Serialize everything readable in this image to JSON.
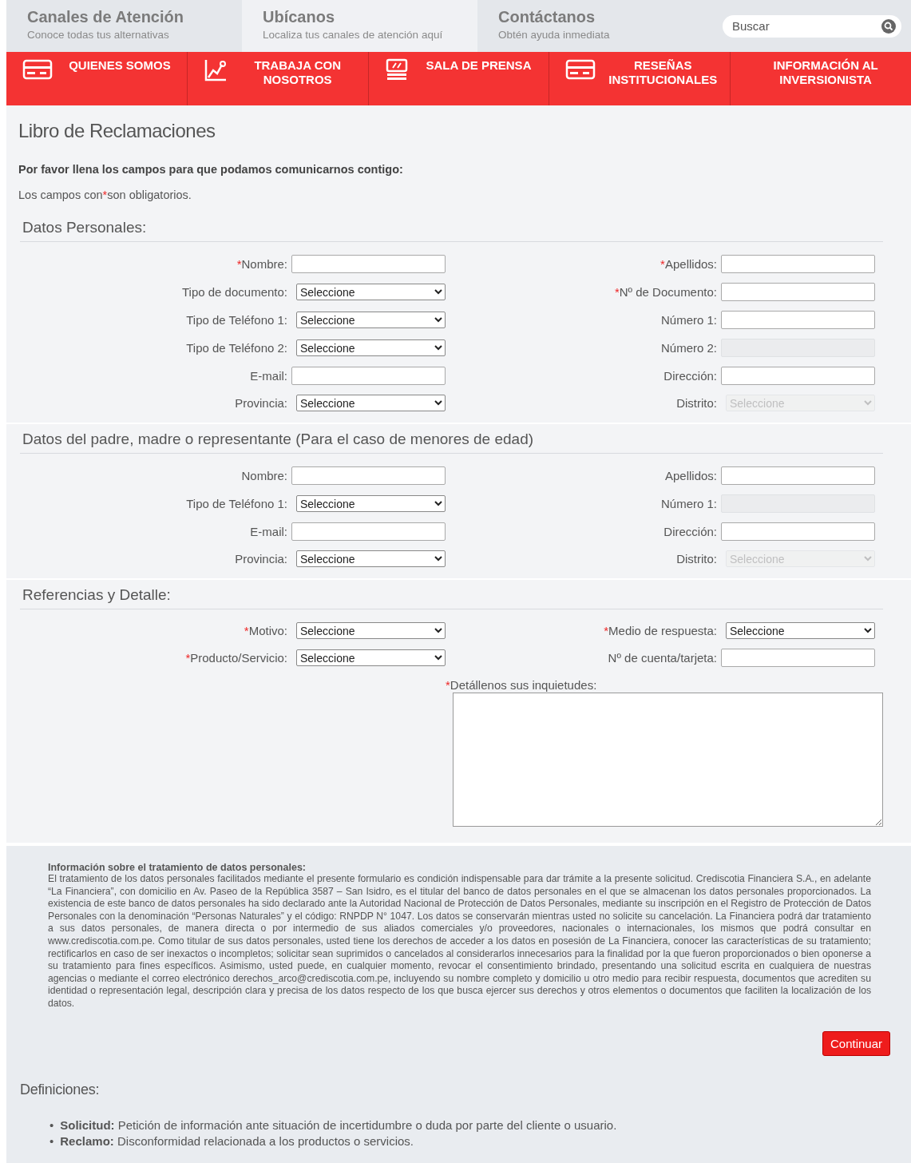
{
  "header": {
    "tabs": [
      {
        "title": "Canales de Atención",
        "subtitle": "Conoce todas tus alternativas",
        "selected": false
      },
      {
        "title": "Ubícanos",
        "subtitle": "Localiza tus canales de atención aquí",
        "selected": true
      },
      {
        "title": "Contáctanos",
        "subtitle": "Obtén ayuda inmediata",
        "selected": false
      }
    ],
    "search": {
      "placeholder": "Buscar"
    }
  },
  "nav": [
    {
      "label": "QUIENES SOMOS"
    },
    {
      "label": "TRABAJA CON NOSOTROS"
    },
    {
      "label": "SALA DE PRENSA"
    },
    {
      "label": "RESEÑAS INSTITUCIONALES"
    },
    {
      "label": "INFORMACIÓN AL INVERSIONISTA"
    }
  ],
  "page_title": "Libro de Reclamaciones",
  "intro": "Por favor llena los campos para que podamos comunicarnos contigo:",
  "required_mark": "*",
  "required_note": {
    "before": "Los campos con",
    "after": "son obligatorios."
  },
  "sections": [
    {
      "title": "Datos Personales:",
      "rows": [
        [
          {
            "label": "Nombre:",
            "required": true,
            "kind": "text",
            "disabled": false
          },
          {
            "label": "Apellidos:",
            "required": true,
            "kind": "text",
            "disabled": false
          }
        ],
        [
          {
            "label": "Tipo de documento:",
            "required": false,
            "kind": "select",
            "value": "Seleccione",
            "disabled": false
          },
          {
            "label": "Nº de Documento:",
            "required": true,
            "kind": "text",
            "disabled": false
          }
        ],
        [
          {
            "label": "Tipo de Teléfono 1:",
            "required": false,
            "kind": "select",
            "value": "Seleccione",
            "disabled": false
          },
          {
            "label": "Número 1:",
            "required": false,
            "kind": "text",
            "disabled": false
          }
        ],
        [
          {
            "label": "Tipo de Teléfono 2:",
            "required": false,
            "kind": "select",
            "value": "Seleccione",
            "disabled": false
          },
          {
            "label": "Número 2:",
            "required": false,
            "kind": "text",
            "disabled": true
          }
        ],
        [
          {
            "label": "E-mail:",
            "required": false,
            "kind": "text",
            "disabled": false
          },
          {
            "label": "Dirección:",
            "required": false,
            "kind": "text",
            "disabled": false
          }
        ],
        [
          {
            "label": "Provincia:",
            "required": false,
            "kind": "select",
            "value": "Seleccione",
            "disabled": false
          },
          {
            "label": "Distrito:",
            "required": false,
            "kind": "select",
            "value": "Seleccione",
            "disabled": true
          }
        ]
      ]
    },
    {
      "title": "Datos del padre, madre o representante (Para el caso de menores de edad)",
      "rows": [
        [
          {
            "label": "Nombre:",
            "required": false,
            "kind": "text",
            "disabled": false
          },
          {
            "label": "Apellidos:",
            "required": false,
            "kind": "text",
            "disabled": false
          }
        ],
        [
          {
            "label": "Tipo de Teléfono 1:",
            "required": false,
            "kind": "select",
            "value": "Seleccione",
            "disabled": false
          },
          {
            "label": "Número 1:",
            "required": false,
            "kind": "text",
            "disabled": true
          }
        ],
        [
          {
            "label": "E-mail:",
            "required": false,
            "kind": "text",
            "disabled": false
          },
          {
            "label": "Dirección:",
            "required": false,
            "kind": "text",
            "disabled": false
          }
        ],
        [
          {
            "label": "Provincia:",
            "required": false,
            "kind": "select",
            "value": "Seleccione",
            "disabled": false
          },
          {
            "label": "Distrito:",
            "required": false,
            "kind": "select",
            "value": "Seleccione",
            "disabled": true
          }
        ]
      ]
    },
    {
      "title": "Referencias y Detalle:",
      "rows": [
        [
          {
            "label": "Motivo:",
            "required": true,
            "kind": "select",
            "value": "Seleccione",
            "disabled": false
          },
          {
            "label": "Medio de respuesta:",
            "required": true,
            "kind": "select",
            "value": "Seleccione",
            "disabled": false
          }
        ],
        [
          {
            "label": "Producto/Servicio:",
            "required": true,
            "kind": "select",
            "value": "Seleccione",
            "disabled": false
          },
          {
            "label": "Nº de cuenta/tarjeta:",
            "required": false,
            "kind": "text",
            "disabled": false
          }
        ]
      ],
      "detail": {
        "label": "Detállenos sus inquietudes:",
        "required": true
      }
    }
  ],
  "privacy": {
    "title": "Información sobre el tratamiento de datos personales:",
    "text": "El tratamiento de los datos personales facilitados mediante el presente formulario es condición indispensable para dar trámite a la presente solicitud. Crediscotia Financiera S.A., en adelante “La Financiera”, con domicilio en Av. Paseo de la República 3587 – San Isidro, es el titular del banco de datos personales en el que se almacenan los datos personales proporcionados. La existencia de este banco de datos personales ha sido declarado ante la Autoridad Nacional de Protección de Datos Personales, mediante su inscripción en el Registro de Protección de Datos Personales con la denominación “Personas Naturales” y el código: RNPDP N° 1047. Los datos se conservarán mientras usted no solicite su cancelación. La Financiera podrá dar tratamiento a sus datos personales, de manera directa o por intermedio de sus aliados comerciales y/o proveedores, nacionales o internacionales, los mismos que podrá consultar en www.crediscotia.com.pe. Como titular de sus datos personales, usted tiene los derechos de acceder a los datos en posesión de La Financiera, conocer las características de su tratamiento; rectificarlos en caso de ser inexactos o incompletos; solicitar sean suprimidos o cancelados al considerarlos innecesarios para la finalidad por la que fueron proporcionados o bien oponerse a su tratamiento para fines específicos. Asimismo, usted puede, en cualquier momento, revocar el consentimiento brindado, presentando una solicitud escrita en cualquiera de nuestras agencias o mediante el correo electrónico derechos_arco@crediscotia.com.pe, incluyendo su nombre completo y domicilio u otro medio para recibir respuesta, documentos que acrediten su identidad o representación legal, descripción clara y precisa de los datos respecto de los que busca ejercer sus derechos y otros elementos o documentos que faciliten la localización de los datos."
  },
  "continue_button": "Continuar",
  "definitions": {
    "title": "Definiciones:",
    "items": [
      {
        "marker": "•",
        "text": "**Solicitud:** Petición de información ante situación de incertidumbre o duda por parte del cliente o usuario."
      },
      {
        "marker": "•",
        "text": "**Reclamo:** Disconformidad relacionada a los productos  o servicios."
      }
    ]
  }
}
